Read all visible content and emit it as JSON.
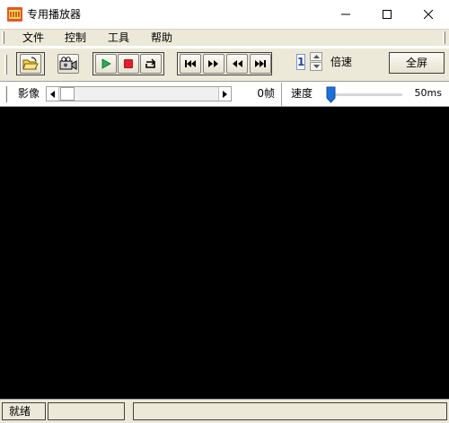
{
  "window": {
    "title": "专用播放器",
    "icons": {
      "app": "player-app-icon",
      "minimize": "minimize-icon",
      "maximize": "maximize-icon",
      "close": "close-icon"
    }
  },
  "menu": {
    "items": [
      {
        "label": "文件"
      },
      {
        "label": "控制"
      },
      {
        "label": "工具"
      },
      {
        "label": "帮助"
      }
    ]
  },
  "toolbar": {
    "buttons": [
      {
        "name": "open-file-button",
        "icon": "folder-open-icon"
      },
      {
        "name": "camera-button",
        "icon": "camera-icon"
      },
      {
        "name": "play-button",
        "icon": "play-icon",
        "color": "#22b14c"
      },
      {
        "name": "stop-button",
        "icon": "stop-icon",
        "color": "#ed1c24"
      },
      {
        "name": "loop-button",
        "icon": "loop-icon"
      },
      {
        "name": "first-frame-button",
        "icon": "skip-first-icon"
      },
      {
        "name": "fast-forward-button",
        "icon": "fast-forward-icon"
      },
      {
        "name": "rewind-button",
        "icon": "rewind-icon"
      },
      {
        "name": "last-frame-button",
        "icon": "skip-last-icon"
      }
    ],
    "speed_multiplier": {
      "value": "1",
      "label": "倍速"
    },
    "fullscreen_label": "全屏"
  },
  "frame_bar": {
    "label": "影像",
    "frame_count": "0帧",
    "position_fraction": 0.0
  },
  "speed_bar": {
    "label": "速度",
    "value": "50ms",
    "slider_fraction": 0.0
  },
  "status": {
    "text": "就绪"
  },
  "colors": {
    "chrome": "#ece9d8",
    "video_background": "#000000",
    "accent": "#1e6fd9"
  }
}
